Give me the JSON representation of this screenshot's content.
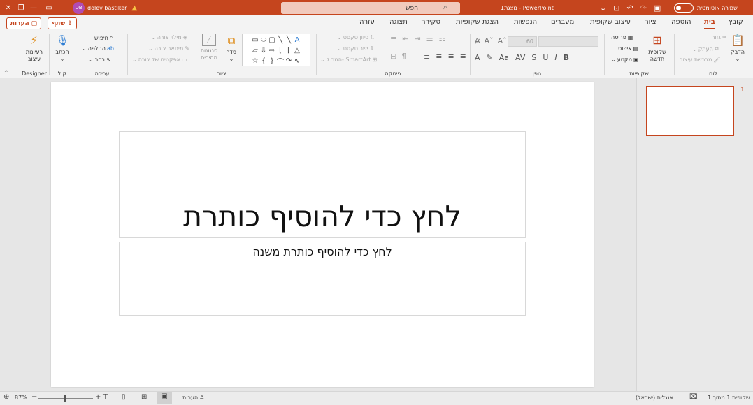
{
  "titlebar": {
    "autosave_label": "שמירה אוטומטית",
    "doc_title": "מצגת1 - PowerPoint",
    "search_placeholder": "חפש",
    "user_name": "dolev bastiker",
    "user_initials": "DB",
    "accent": "#c5451e"
  },
  "tabs": [
    {
      "label": "קובץ"
    },
    {
      "label": "בית",
      "active": true
    },
    {
      "label": "הוספה"
    },
    {
      "label": "ציור"
    },
    {
      "label": "עיצוב שקופית"
    },
    {
      "label": "מעברים"
    },
    {
      "label": "הנפשות"
    },
    {
      "label": "הצגת שקופיות"
    },
    {
      "label": "סקירה"
    },
    {
      "label": "תצוגה"
    },
    {
      "label": "עזרה"
    }
  ],
  "share": {
    "share_label": "שתף",
    "comments_label": "הערות"
  },
  "ribbon": {
    "clipboard": {
      "group": "לוח",
      "paste": "הדבק",
      "cut": "גזור",
      "copy": "העתק",
      "format_painter": "מברשת עיצוב"
    },
    "slides": {
      "group": "שקופיות",
      "new_slide": "שקופית חדשה",
      "layout": "פריסה",
      "reset": "איפוס",
      "section": "מקטע"
    },
    "font": {
      "group": "גופן",
      "font_size": "60",
      "bold": "B",
      "italic": "I",
      "underline": "U",
      "strike": "S"
    },
    "paragraph": {
      "group": "פיסקה",
      "text_direction": "כיוון טקסט",
      "align_text": "ישר טקסט",
      "smartart": "המר ל- SmartArt"
    },
    "drawing": {
      "group": "ציור",
      "arrange": "סדר",
      "quick_styles": "סגנונות מהירים",
      "shape_fill": "מילוי צורה",
      "shape_outline": "מיתאר צורה",
      "shape_effects": "אפקטים של צורה"
    },
    "editing": {
      "group": "עריכה",
      "find": "חיפוש",
      "replace": "החלפה",
      "select": "בחר"
    },
    "voice": {
      "group": "קול",
      "dictate": "הכתב"
    },
    "designer": {
      "group": "Designer",
      "design_ideas": "רעיונות עיצוב"
    }
  },
  "slide": {
    "title_placeholder": "לחץ כדי להוסיף כותרת",
    "subtitle_placeholder": "לחץ כדי להוסיף כותרת משנה"
  },
  "thumbnails": [
    {
      "number": "1"
    }
  ],
  "statusbar": {
    "slide_count": "שקופית 1 מתוך 1",
    "language": "אנגלית (ישראל)",
    "notes_label": "הערות",
    "zoom": "87%"
  }
}
